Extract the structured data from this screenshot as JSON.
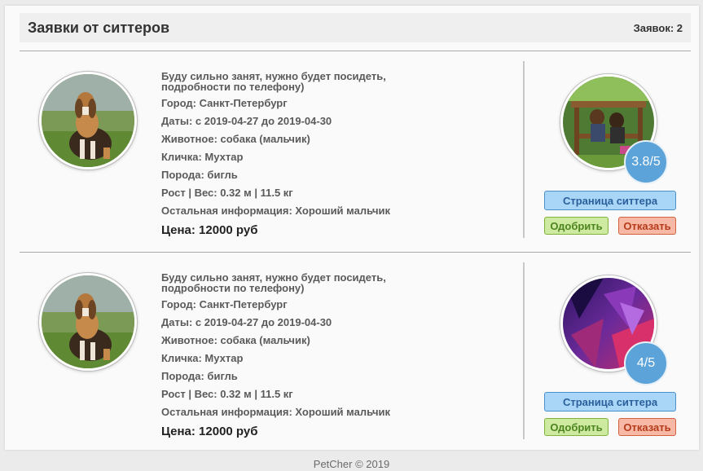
{
  "header": {
    "title": "Заявки от ситтеров",
    "count": "Заявок: 2"
  },
  "requests": [
    {
      "description": "Буду сильно занят, нужно будет посидеть, подробности по телефону)",
      "city": "Город: Санкт-Петербург",
      "dates": "Даты: с 2019-04-27 до 2019-04-30",
      "animal": "Животное: собака (мальчик)",
      "nickname": "Кличка: Мухтар",
      "breed": "Порода: бигль",
      "size": "Рост | Вес: 0.32 м | 11.5 кг",
      "other": "Остальная информация: Хороший мальчик",
      "price": "Цена: 12000 руб",
      "rating": "3.8/5",
      "buttons": {
        "page": "Страница ситтера",
        "approve": "Одобрить",
        "reject": "Отказать"
      }
    },
    {
      "description": "Буду сильно занят, нужно будет посидеть, подробности по телефону)",
      "city": "Город: Санкт-Петербург",
      "dates": "Даты: с 2019-04-27 до 2019-04-30",
      "animal": "Животное: собака (мальчик)",
      "nickname": "Кличка: Мухтар",
      "breed": "Порода: бигль",
      "size": "Рост | Вес: 0.32 м | 11.5 кг",
      "other": "Остальная информация: Хороший мальчик",
      "price": "Цена: 12000 руб",
      "rating": "4/5",
      "buttons": {
        "page": "Страница ситтера",
        "approve": "Одобрить",
        "reject": "Отказать"
      }
    }
  ],
  "footer": "PetCher © 2019",
  "colors": {
    "rating_badge": "#5ba3d9",
    "page_button": "#a9d6f7",
    "approve_button": "#cdeaa0",
    "reject_button": "#f7b8a6"
  }
}
